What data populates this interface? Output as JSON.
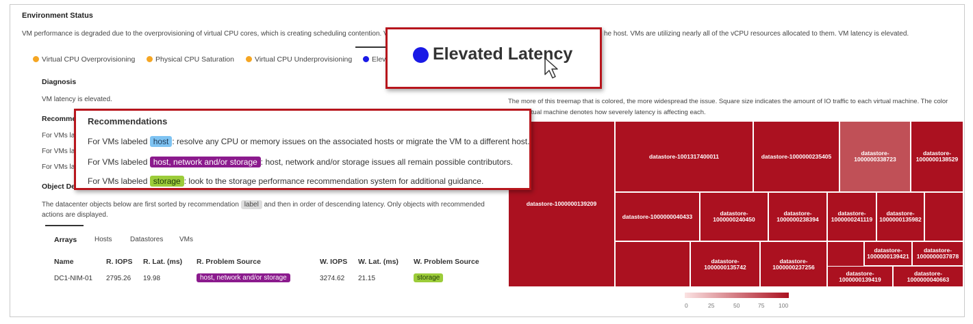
{
  "header": {
    "title": "Environment Status",
    "description_left": "VM performance is degraded due to the overprovisioning of virtual CPU cores, which is creating scheduling contention. VM",
    "description_right": "he host. VMs are utilizing nearly all of the vCPU resources allocated to them. VM latency is elevated."
  },
  "issue_tabs": [
    {
      "label": "Virtual CPU Overprovisioning",
      "color": "#f5a623"
    },
    {
      "label": "Physical CPU Saturation",
      "color": "#f5a623"
    },
    {
      "label": "Virtual CPU Underprovisioning",
      "color": "#f5a623"
    },
    {
      "label": "Elev",
      "color": "#1a1ae6"
    }
  ],
  "latency_callout": {
    "label": "Elevated Latency",
    "dot_color": "#1a1ae6"
  },
  "diagnosis": {
    "heading": "Diagnosis",
    "text": "VM latency is elevated."
  },
  "recommendations_bg": {
    "heading_partial": "Recomme",
    "lines": [
      "For VMs lal",
      "For VMs lal",
      "For VMs lal"
    ]
  },
  "recommendations_popup": {
    "heading": "Recommendations",
    "items": [
      {
        "prefix": "For VMs labeled ",
        "tag": "host",
        "tag_bg": "#7ec3f2",
        "tag_fg": "#1e3b5a",
        "suffix": ": resolve any CPU or memory issues on the associated hosts or migrate the VM to a different host."
      },
      {
        "prefix": "For VMs labeled ",
        "tag": "host, network and/or storage",
        "tag_bg": "#8b1a8d",
        "tag_fg": "#ffffff",
        "suffix": ": host, network and/or storage issues all remain possible contributors."
      },
      {
        "prefix": "For VMs labeled ",
        "tag": "storage",
        "tag_bg": "#9ccc3a",
        "tag_fg": "#1f3a0a",
        "suffix": ": look to the storage performance recommendation system for additional guidance."
      }
    ]
  },
  "object_details": {
    "heading_partial": "Object Det",
    "desc_line1_pre": "The datacenter objects below are first sorted by recommendation ",
    "desc_tag": "label",
    "desc_line1_post": " and then in order of descending latency. Only objects with recommended",
    "desc_line2": "actions are displayed."
  },
  "object_tabs": [
    "Arrays",
    "Hosts",
    "Datastores",
    "VMs"
  ],
  "table": {
    "columns": [
      "Name",
      "R. IOPS",
      "R. Lat. (ms)",
      "R. Problem Source",
      "W. IOPS",
      "W. Lat. (ms)",
      "W. Problem Source"
    ],
    "rows": [
      {
        "name": "DC1-NIM-01",
        "r_iops": "2795.26",
        "r_lat": "19.98",
        "r_src": "host, network and/or storage",
        "w_iops": "3274.62",
        "w_lat": "21.15",
        "w_src": "storage"
      }
    ]
  },
  "treemap": {
    "desc_line1": "The more of this treemap that is colored, the more widespread the issue. Square size indicates the amount of IO traffic to each virtual machine. The color",
    "desc_line2": "th        gh virtual machine denotes how severely latency is affecting each.",
    "labels": {
      "a": "datastore-1000000139209",
      "b": "datastore-1001317400011",
      "c": "datastore-1000000235405",
      "d1": "datastore-",
      "d2": "1000000338723",
      "e1": "datastore-",
      "e2": "1000000138529",
      "f": "datastore-1000000040433",
      "g1": "datastore-",
      "g2": "1000000240450",
      "h1": "datastore-",
      "h2": "1000000238394",
      "i1": "datastore-",
      "i2": "1000000241119",
      "j1": "datastore-",
      "j2": "1000000135982",
      "k1": "datastore-",
      "k2": "1000000135742",
      "l1": "datastore-",
      "l2": "1000000237256",
      "m1": "datastore-",
      "m2": "1000000139421",
      "n1": "datastore-",
      "n2": "1000000037878",
      "o1": "datastore-",
      "o2": "1000000139419",
      "p1": "datastore-",
      "p2": "1000000040663"
    },
    "legend_ticks": [
      "0",
      "25",
      "50",
      "75",
      "100"
    ]
  }
}
